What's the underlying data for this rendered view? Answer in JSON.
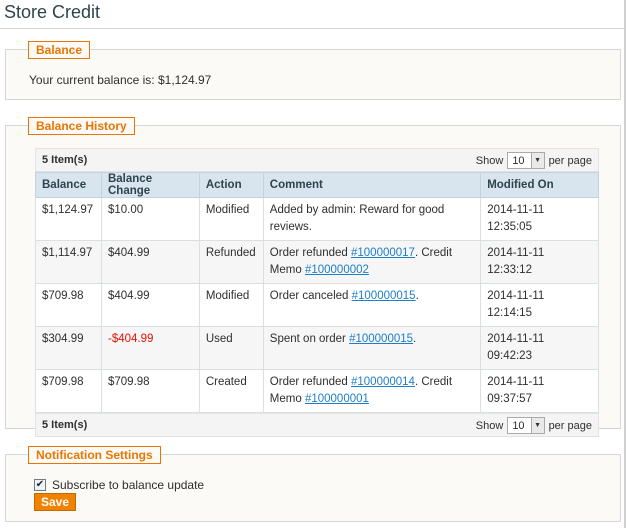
{
  "page": {
    "title": "Store Credit"
  },
  "balance": {
    "legend": "Balance",
    "text": "Your current balance is: $1,124.97"
  },
  "history": {
    "legend": "Balance History",
    "items_count": "5 Item(s)",
    "show_label": "Show",
    "per_page_value": "10",
    "per_page_label": "per page",
    "columns": [
      "Balance",
      "Balance Change",
      "Action",
      "Comment",
      "Modified On"
    ],
    "rows": [
      {
        "balance": "$1,124.97",
        "change": "$10.00",
        "action": "Modified",
        "comment_pre": "Added by admin: Reward for good reviews.",
        "link1": "",
        "mid": "",
        "link2": "",
        "post": "",
        "date": "2014-11-11",
        "time": "12:35:05"
      },
      {
        "balance": "$1,114.97",
        "change": "$404.99",
        "action": "Refunded",
        "comment_pre": "Order refunded ",
        "link1": "#100000017",
        "mid": ". Credit Memo ",
        "link2": "#100000002",
        "post": "",
        "date": "2014-11-11",
        "time": "12:33:12"
      },
      {
        "balance": "$709.98",
        "change": "$404.99",
        "action": "Modified",
        "comment_pre": "Order canceled ",
        "link1": "#100000015",
        "mid": ".",
        "link2": "",
        "post": "",
        "date": "2014-11-11",
        "time": "12:14:15"
      },
      {
        "balance": "$304.99",
        "change": "-$404.99",
        "action": "Used",
        "comment_pre": "Spent on order ",
        "link1": "#100000015",
        "mid": ".",
        "link2": "",
        "post": "",
        "date": "2014-11-11",
        "time": "09:42:23"
      },
      {
        "balance": "$709.98",
        "change": "$709.98",
        "action": "Created",
        "comment_pre": "Order refunded ",
        "link1": "#100000014",
        "mid": ". Credit Memo ",
        "link2": "#100000001",
        "post": "",
        "date": "2014-11-11",
        "time": "09:37:57"
      }
    ]
  },
  "notifications": {
    "legend": "Notification Settings",
    "checkbox_label": "Subscribe to balance update",
    "checked": true,
    "save_label": "Save"
  },
  "colors": {
    "accent": "#ea7601",
    "button": "#f18200",
    "header_bg": "#d9e5ee",
    "negative": "#e41101",
    "link": "#1e7ec8"
  }
}
